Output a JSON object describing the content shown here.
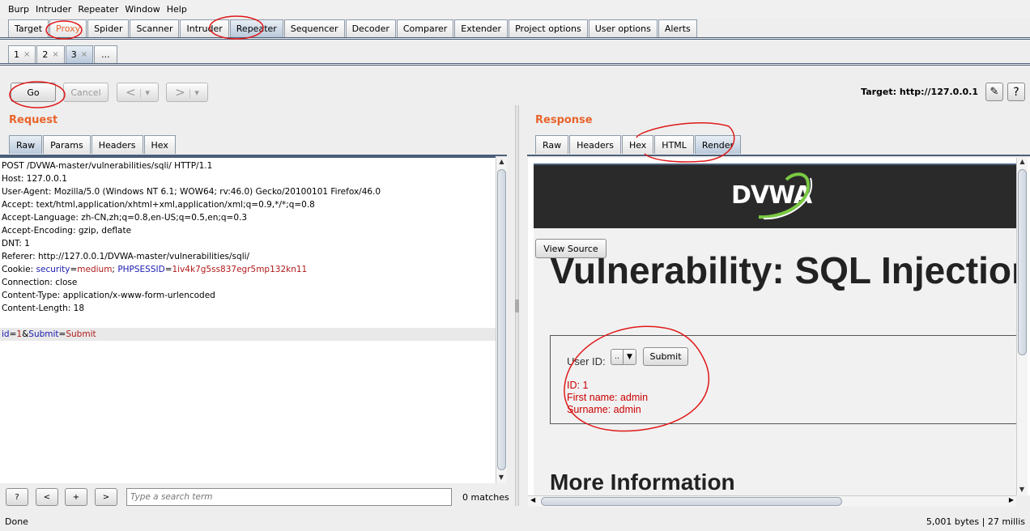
{
  "menu": [
    "Burp",
    "Intruder",
    "Repeater",
    "Window",
    "Help"
  ],
  "main_tabs": [
    "Target",
    "Proxy",
    "Spider",
    "Scanner",
    "Intruder",
    "Repeater",
    "Sequencer",
    "Decoder",
    "Comparer",
    "Extender",
    "Project options",
    "User options",
    "Alerts"
  ],
  "repeater_tabs": [
    {
      "label": "1",
      "close": "×"
    },
    {
      "label": "2",
      "close": "×"
    },
    {
      "label": "3",
      "close": "×"
    },
    {
      "label": "...",
      "close": ""
    }
  ],
  "toolbar": {
    "go": "Go",
    "cancel": "Cancel",
    "back": "<",
    "back_dd": "▾",
    "forward": ">",
    "forward_dd": "▾",
    "target": "Target: http://127.0.0.1",
    "edit_icon": "✎",
    "help": "?"
  },
  "request": {
    "title": "Request",
    "tabs": [
      "Raw",
      "Params",
      "Headers",
      "Hex"
    ],
    "lines": [
      "POST /DVWA-master/vulnerabilities/sqli/ HTTP/1.1",
      "Host: 127.0.0.1",
      "User-Agent: Mozilla/5.0 (Windows NT 6.1; WOW64; rv:46.0) Gecko/20100101 Firefox/46.0",
      "Accept: text/html,application/xhtml+xml,application/xml;q=0.9,*/*;q=0.8",
      "Accept-Language: zh-CN,zh;q=0.8,en-US;q=0.5,en;q=0.3",
      "Accept-Encoding: gzip, deflate",
      "DNT: 1",
      "Referer: http://127.0.0.1/DVWA-master/vulnerabilities/sqli/"
    ],
    "cookie": {
      "prefix": "Cookie: ",
      "k1": "security",
      "eq1": "=",
      "v1": "medium",
      "sep": "; ",
      "k2": "PHPSESSID",
      "eq2": "=",
      "v2": "1iv4k7g5ss837egr5mp132kn11"
    },
    "lines2": [
      "Connection: close",
      "Content-Type: application/x-www-form-urlencoded",
      "Content-Length: 18"
    ],
    "body": {
      "k1": "id",
      "eq1": "=",
      "v1": "1",
      "amp": "&",
      "k2": "Submit",
      "eq2": "=",
      "v2": "Submit"
    }
  },
  "search": {
    "help": "?",
    "prev": "<",
    "add": "+",
    "next": ">",
    "placeholder": "Type a search term",
    "matches": "0 matches"
  },
  "response": {
    "title": "Response",
    "tabs": [
      "Raw",
      "Headers",
      "Hex",
      "HTML",
      "Render"
    ],
    "render": {
      "logo": "DVWA",
      "view_source": "View Source",
      "heading": "Vulnerability: SQL Injection",
      "user_id_label": "User ID:",
      "select_value": "..",
      "submit": "Submit",
      "result_id": "ID: 1",
      "result_first": "First name: admin",
      "result_surname": "Surname: admin",
      "more_info": "More Information"
    }
  },
  "status": {
    "left": "Done",
    "right": "5,001 bytes | 27 millis"
  },
  "colors": {
    "accent_orange": "#e8642c",
    "annotation_red": "#e01818",
    "dvwa_green": "#7ac943"
  }
}
